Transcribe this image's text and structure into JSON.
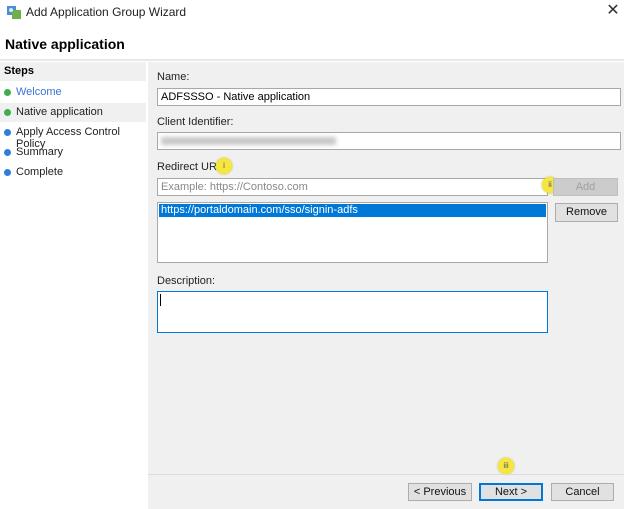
{
  "window": {
    "title": "Add Application Group Wizard",
    "close_icon": "close-icon"
  },
  "header": {
    "title": "Native application"
  },
  "steps": {
    "heading": "Steps",
    "items": [
      {
        "label": "Welcome",
        "status": "done",
        "color": "#3fae49"
      },
      {
        "label": "Native application",
        "status": "current",
        "color": "#3fae49"
      },
      {
        "label": "Apply Access Control Policy",
        "status": "pending",
        "color": "#2f7fd8"
      },
      {
        "label": "Summary",
        "status": "pending",
        "color": "#2f7fd8"
      },
      {
        "label": "Complete",
        "status": "pending",
        "color": "#2f7fd8"
      }
    ]
  },
  "form": {
    "name_label": "Name:",
    "name_value": "ADFSSSO - Native application",
    "client_id_label": "Client Identifier:",
    "redirect_label": "Redirect URI:",
    "redirect_placeholder": "Example: https://Contoso.com",
    "add_label": "Add",
    "remove_label": "Remove",
    "redirect_list": [
      "https://portaldomain.com/sso/signin-adfs"
    ],
    "description_label": "Description:",
    "description_value": ""
  },
  "badges": [
    "i",
    "ii",
    "iii"
  ],
  "footer": {
    "previous": "< Previous",
    "next": "Next >",
    "cancel": "Cancel"
  },
  "colors": {
    "selection": "#0078d7",
    "badge": "#f5e642",
    "link": "#3b73d9"
  }
}
